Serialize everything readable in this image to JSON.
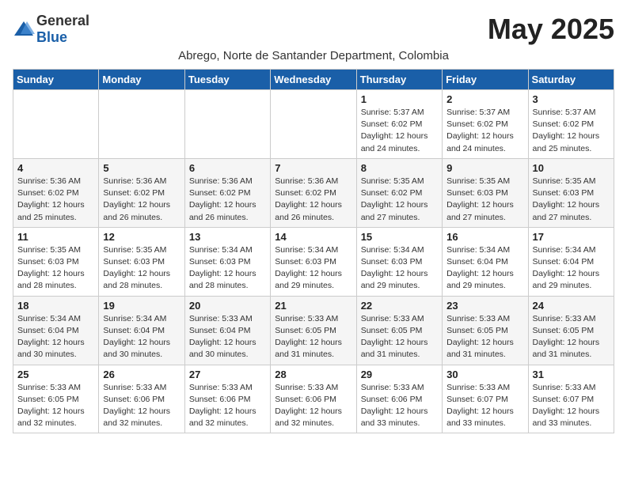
{
  "header": {
    "logo_general": "General",
    "logo_blue": "Blue",
    "month_title": "May 2025",
    "subtitle": "Abrego, Norte de Santander Department, Colombia"
  },
  "weekdays": [
    "Sunday",
    "Monday",
    "Tuesday",
    "Wednesday",
    "Thursday",
    "Friday",
    "Saturday"
  ],
  "weeks": [
    [
      {
        "day": "",
        "info": ""
      },
      {
        "day": "",
        "info": ""
      },
      {
        "day": "",
        "info": ""
      },
      {
        "day": "",
        "info": ""
      },
      {
        "day": "1",
        "info": "Sunrise: 5:37 AM\nSunset: 6:02 PM\nDaylight: 12 hours\nand 24 minutes."
      },
      {
        "day": "2",
        "info": "Sunrise: 5:37 AM\nSunset: 6:02 PM\nDaylight: 12 hours\nand 24 minutes."
      },
      {
        "day": "3",
        "info": "Sunrise: 5:37 AM\nSunset: 6:02 PM\nDaylight: 12 hours\nand 25 minutes."
      }
    ],
    [
      {
        "day": "4",
        "info": "Sunrise: 5:36 AM\nSunset: 6:02 PM\nDaylight: 12 hours\nand 25 minutes."
      },
      {
        "day": "5",
        "info": "Sunrise: 5:36 AM\nSunset: 6:02 PM\nDaylight: 12 hours\nand 26 minutes."
      },
      {
        "day": "6",
        "info": "Sunrise: 5:36 AM\nSunset: 6:02 PM\nDaylight: 12 hours\nand 26 minutes."
      },
      {
        "day": "7",
        "info": "Sunrise: 5:36 AM\nSunset: 6:02 PM\nDaylight: 12 hours\nand 26 minutes."
      },
      {
        "day": "8",
        "info": "Sunrise: 5:35 AM\nSunset: 6:02 PM\nDaylight: 12 hours\nand 27 minutes."
      },
      {
        "day": "9",
        "info": "Sunrise: 5:35 AM\nSunset: 6:03 PM\nDaylight: 12 hours\nand 27 minutes."
      },
      {
        "day": "10",
        "info": "Sunrise: 5:35 AM\nSunset: 6:03 PM\nDaylight: 12 hours\nand 27 minutes."
      }
    ],
    [
      {
        "day": "11",
        "info": "Sunrise: 5:35 AM\nSunset: 6:03 PM\nDaylight: 12 hours\nand 28 minutes."
      },
      {
        "day": "12",
        "info": "Sunrise: 5:35 AM\nSunset: 6:03 PM\nDaylight: 12 hours\nand 28 minutes."
      },
      {
        "day": "13",
        "info": "Sunrise: 5:34 AM\nSunset: 6:03 PM\nDaylight: 12 hours\nand 28 minutes."
      },
      {
        "day": "14",
        "info": "Sunrise: 5:34 AM\nSunset: 6:03 PM\nDaylight: 12 hours\nand 29 minutes."
      },
      {
        "day": "15",
        "info": "Sunrise: 5:34 AM\nSunset: 6:03 PM\nDaylight: 12 hours\nand 29 minutes."
      },
      {
        "day": "16",
        "info": "Sunrise: 5:34 AM\nSunset: 6:04 PM\nDaylight: 12 hours\nand 29 minutes."
      },
      {
        "day": "17",
        "info": "Sunrise: 5:34 AM\nSunset: 6:04 PM\nDaylight: 12 hours\nand 29 minutes."
      }
    ],
    [
      {
        "day": "18",
        "info": "Sunrise: 5:34 AM\nSunset: 6:04 PM\nDaylight: 12 hours\nand 30 minutes."
      },
      {
        "day": "19",
        "info": "Sunrise: 5:34 AM\nSunset: 6:04 PM\nDaylight: 12 hours\nand 30 minutes."
      },
      {
        "day": "20",
        "info": "Sunrise: 5:33 AM\nSunset: 6:04 PM\nDaylight: 12 hours\nand 30 minutes."
      },
      {
        "day": "21",
        "info": "Sunrise: 5:33 AM\nSunset: 6:05 PM\nDaylight: 12 hours\nand 31 minutes."
      },
      {
        "day": "22",
        "info": "Sunrise: 5:33 AM\nSunset: 6:05 PM\nDaylight: 12 hours\nand 31 minutes."
      },
      {
        "day": "23",
        "info": "Sunrise: 5:33 AM\nSunset: 6:05 PM\nDaylight: 12 hours\nand 31 minutes."
      },
      {
        "day": "24",
        "info": "Sunrise: 5:33 AM\nSunset: 6:05 PM\nDaylight: 12 hours\nand 31 minutes."
      }
    ],
    [
      {
        "day": "25",
        "info": "Sunrise: 5:33 AM\nSunset: 6:05 PM\nDaylight: 12 hours\nand 32 minutes."
      },
      {
        "day": "26",
        "info": "Sunrise: 5:33 AM\nSunset: 6:06 PM\nDaylight: 12 hours\nand 32 minutes."
      },
      {
        "day": "27",
        "info": "Sunrise: 5:33 AM\nSunset: 6:06 PM\nDaylight: 12 hours\nand 32 minutes."
      },
      {
        "day": "28",
        "info": "Sunrise: 5:33 AM\nSunset: 6:06 PM\nDaylight: 12 hours\nand 32 minutes."
      },
      {
        "day": "29",
        "info": "Sunrise: 5:33 AM\nSunset: 6:06 PM\nDaylight: 12 hours\nand 33 minutes."
      },
      {
        "day": "30",
        "info": "Sunrise: 5:33 AM\nSunset: 6:07 PM\nDaylight: 12 hours\nand 33 minutes."
      },
      {
        "day": "31",
        "info": "Sunrise: 5:33 AM\nSunset: 6:07 PM\nDaylight: 12 hours\nand 33 minutes."
      }
    ]
  ]
}
